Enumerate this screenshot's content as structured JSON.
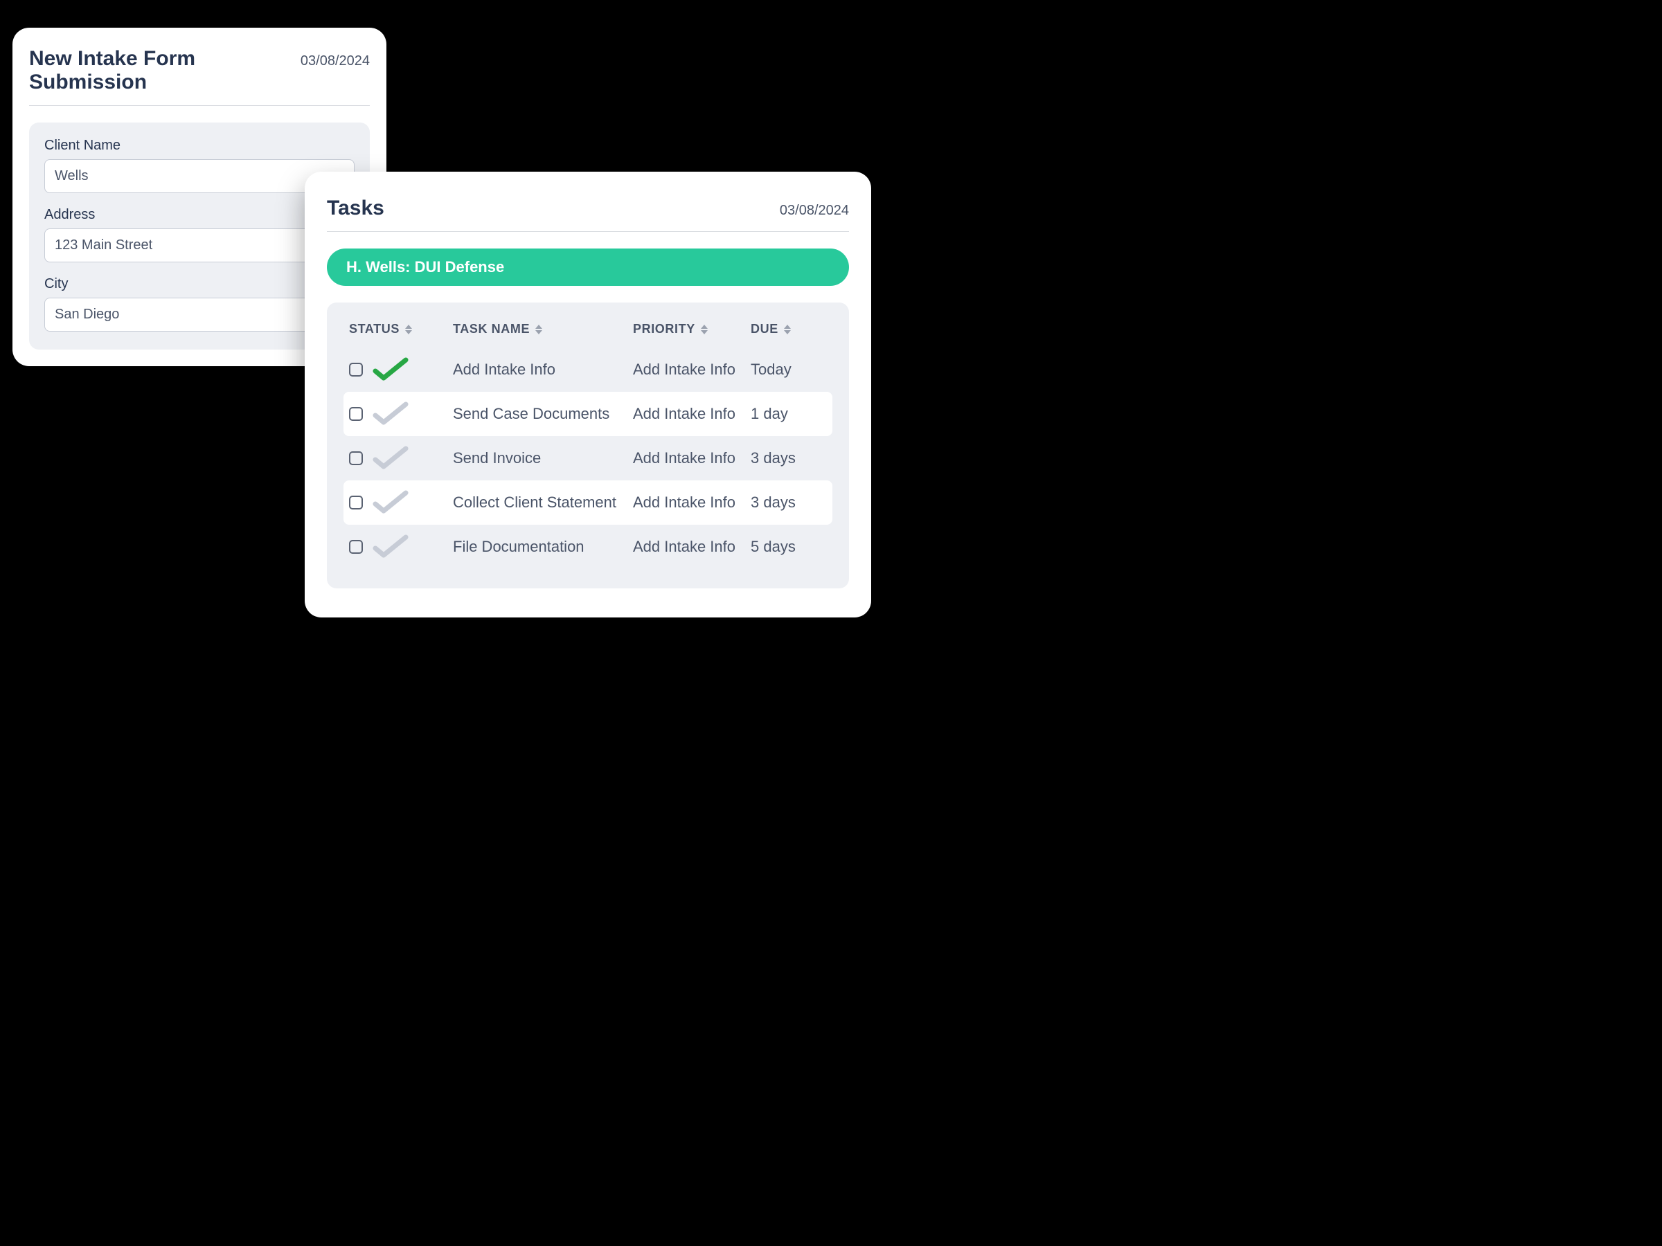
{
  "intake": {
    "title": "New Intake Form Submission",
    "date": "03/08/2024",
    "fields": {
      "client_name_label": "Client Name",
      "client_name_value": "Wells",
      "address_label": "Address",
      "address_value": "123 Main Street",
      "city_label": "City",
      "city_value": "San Diego"
    }
  },
  "tasks": {
    "title": "Tasks",
    "date": "03/08/2024",
    "case_label": "H. Wells: DUI Defense",
    "columns": {
      "status": "STATUS",
      "task_name": "TASK NAME",
      "priority": "PRIORITY",
      "due": "DUE"
    },
    "rows": [
      {
        "done": true,
        "name": "Add Intake Info",
        "priority": "Add Intake Info",
        "due": "Today"
      },
      {
        "done": false,
        "name": "Send Case Documents",
        "priority": "Add Intake Info",
        "due": "1 day"
      },
      {
        "done": false,
        "name": "Send Invoice",
        "priority": "Add Intake Info",
        "due": "3 days"
      },
      {
        "done": false,
        "name": "Collect Client Statement",
        "priority": "Add Intake Info",
        "due": "3 days"
      },
      {
        "done": false,
        "name": "File Documentation",
        "priority": "Add Intake Info",
        "due": "5 days"
      }
    ]
  },
  "colors": {
    "done_check": "#27a744",
    "pending_check": "#c7ccd6",
    "accent": "#28c99b"
  }
}
